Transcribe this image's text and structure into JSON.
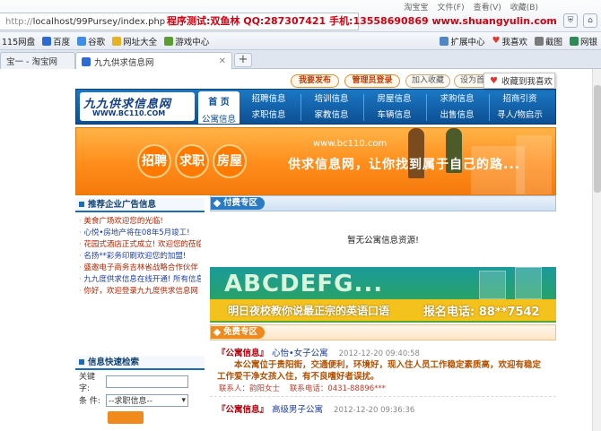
{
  "browser": {
    "top_status": [
      "淘宝宝",
      "文件(F)",
      "查看(V)",
      "收藏(B)"
    ],
    "url_scheme": "http://",
    "url_rest": "localhost/99Pursey/index.php",
    "red_line": "程序测试:双鱼林 QQ:287307421 手机:13558690869 www.shuangyulin.com",
    "bookmarks": [
      "115网盘",
      "百度",
      "谷歌",
      "网址大全",
      "游戏中心"
    ],
    "bookmarks_right": [
      "扩展中心",
      "我喜欢",
      "截图",
      "网银"
    ],
    "tabs": [
      {
        "label": "宝一 - 淘宝网",
        "active": false
      },
      {
        "label": "九九供求信息网",
        "active": true
      }
    ]
  },
  "site": {
    "toplinks": [
      "我要发布",
      "管理员登录",
      "加入收藏",
      "设为首页"
    ],
    "fav_popup": "收藏到我喜欢",
    "logo_title": "九九供求信息网",
    "logo_url": "WWW.BC110.COM",
    "nav_home_top": "首 页",
    "nav_home_bottom": "公寓信息",
    "nav_top": [
      "招聘信息",
      "培训信息",
      "房屋信息",
      "求购信息",
      "招商引资"
    ],
    "nav_bottom": [
      "求职信息",
      "家教信息",
      "车辆信息",
      "出售信息",
      "寻人/物启示"
    ],
    "banner_circles": [
      "招聘",
      "求职",
      "房屋"
    ],
    "banner_url": "www.bc110.com",
    "banner_slogan": "供求信息网，让你找到属于自己的路...",
    "ads_head": "推荐企业广告信息",
    "ads": [
      "美食广场欢迎您的光临!",
      "心悦•房地产将在08年5月竣工!",
      "花园式酒店正式成立! 欢迎您的莅临",
      "名扬**彩务印刷欢迎您的加盟!",
      "盛邀电子商务吉林省战略合作伙伴",
      "九九度供求信息在线开通! 所有信息",
      "你好，欢迎登录九九度供求信息网"
    ],
    "search_head": "信息快速检索",
    "search_keyword_label": "关键字:",
    "search_keyword_value": "",
    "search_cond_label": "条  件:",
    "search_cond_value": "--求职信息--",
    "paid_head": "付费专区",
    "paid_empty": "暂无公寓信息资源!",
    "ad_big": "ABCDEFG...",
    "ad_slogan": "明日夜校教你说最正宗的英语口语",
    "ad_phone": "报名电话: 88**7542",
    "free_head": "免费专区",
    "listings": [
      {
        "cat": "『公寓信息』",
        "title": "心怡•女子公寓",
        "time": "2012-12-20 09:40:58",
        "desc": "本公寓位于贵阳街，交通便利，环境好，现入住人员工作稳定素质高，欢迎有稳定工作爱干净女孩入住，有不良嗜好者误扰。",
        "contact_label": "联系人：",
        "contact_name": "韵阳女士",
        "phone_label": "联系电话：",
        "phone": "0431-88896***"
      },
      {
        "cat": "『公寓信息』",
        "title": "高级男子公寓",
        "time": "2012-12-20 09:36:36",
        "desc": "",
        "contact_label": "",
        "contact_name": "",
        "phone_label": "",
        "phone": ""
      }
    ]
  },
  "colors": {
    "nav_blue": "#0c4f93",
    "banner_orange": "#ff8c1a",
    "accent_red": "#d4000f"
  }
}
